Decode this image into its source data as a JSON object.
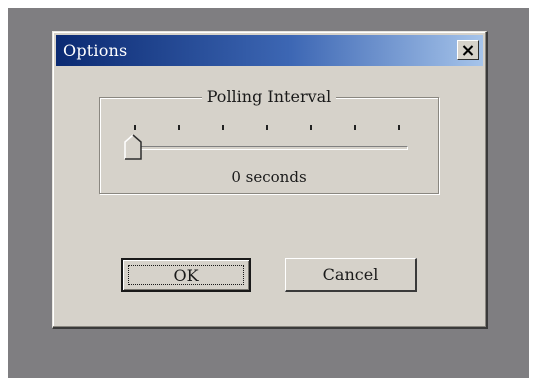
{
  "dialog": {
    "title": "Options",
    "close_symbol": "×"
  },
  "polling": {
    "group_label": "Polling Interval",
    "value_text": "0 seconds",
    "slider_position": 0,
    "tick_count": 7
  },
  "buttons": {
    "ok_label": "OK",
    "cancel_label": "Cancel"
  },
  "colors": {
    "desktop": "#7f7e81",
    "dialog_face": "#d6d2ca",
    "title_start": "#0b2a72",
    "title_end": "#a6c4ea"
  },
  "icons": [
    "close-icon",
    "slider-thumb-icon"
  ]
}
